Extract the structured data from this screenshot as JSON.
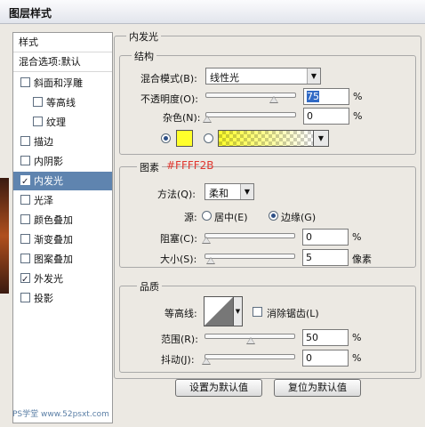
{
  "window": {
    "title": "图层样式"
  },
  "sidebar": {
    "header": "样式",
    "blend_options": "混合选项:默认",
    "items": [
      {
        "label": "斜面和浮雕",
        "checked": false
      },
      {
        "label": "等高线",
        "checked": false
      },
      {
        "label": "纹理",
        "checked": false
      },
      {
        "label": "描边",
        "checked": false
      },
      {
        "label": "内阴影",
        "checked": false
      },
      {
        "label": "内发光",
        "checked": true
      },
      {
        "label": "光泽",
        "checked": false
      },
      {
        "label": "颜色叠加",
        "checked": false
      },
      {
        "label": "渐变叠加",
        "checked": false
      },
      {
        "label": "图案叠加",
        "checked": false
      },
      {
        "label": "外发光",
        "checked": true
      },
      {
        "label": "投影",
        "checked": false
      }
    ],
    "selected_label": "内发光"
  },
  "panel": {
    "title": "内发光"
  },
  "structure": {
    "title": "结构",
    "blend_mode_label": "混合模式(B):",
    "blend_mode_value": "线性光",
    "opacity_label": "不透明度(O):",
    "opacity_value": "75",
    "opacity_unit": "%",
    "noise_label": "杂色(N):",
    "noise_value": "0",
    "noise_unit": "%",
    "color_swatch": "#FFFF2B",
    "gradient_colors": [
      "#FFFF2B",
      "#FFFFFF"
    ]
  },
  "elements": {
    "title": "图素",
    "color_annotation": "#FFFF2B",
    "method_label": "方法(Q):",
    "method_value": "柔和",
    "source_label": "源:",
    "source_center": "居中(E)",
    "source_edge": "边缘(G)",
    "choke_label": "阻塞(C):",
    "choke_value": "0",
    "choke_unit": "%",
    "size_label": "大小(S):",
    "size_value": "5",
    "size_unit": "像素"
  },
  "quality": {
    "title": "品质",
    "contour_label": "等高线:",
    "anti_alias_label": "消除锯齿(L)",
    "range_label": "范围(R):",
    "range_value": "50",
    "range_unit": "%",
    "jitter_label": "抖动(J):",
    "jitter_value": "0",
    "jitter_unit": "%"
  },
  "buttons": {
    "set_default": "设置为默认值",
    "reset_default": "复位为默认值"
  },
  "watermark": {
    "text": "PS学堂 www.52psxt.com"
  },
  "slider_levels": {
    "opacity": 0.75,
    "noise": 0.0,
    "choke": 0.0,
    "size": 0.05,
    "range": 0.5,
    "jitter": 0.0
  }
}
